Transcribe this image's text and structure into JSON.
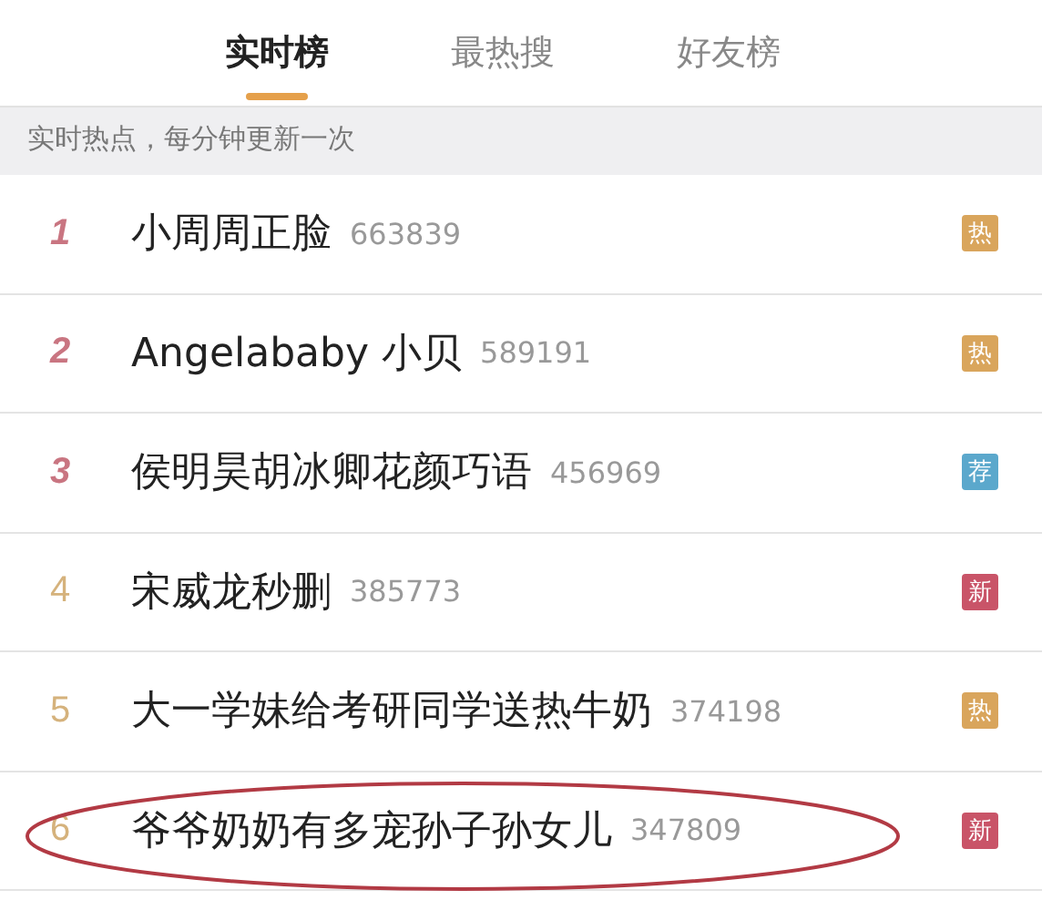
{
  "tabs": [
    {
      "label": "实时榜",
      "selected": true
    },
    {
      "label": "最热搜",
      "selected": false
    },
    {
      "label": "好友榜",
      "selected": false
    }
  ],
  "notice": "实时热点，每分钟更新一次",
  "rows": [
    {
      "rank": "1",
      "top": true,
      "title": "小周周正脸",
      "count": "663839",
      "badge": "热",
      "color": "#d9a55c",
      "circled": false
    },
    {
      "rank": "2",
      "top": true,
      "title": "Angelababy 小贝",
      "count": "589191",
      "badge": "热",
      "color": "#d9a55c",
      "circled": false
    },
    {
      "rank": "3",
      "top": true,
      "title": "侯明昊胡冰卿花颜巧语",
      "count": "456969",
      "badge": "荐",
      "color": "#5ba8cc",
      "circled": false
    },
    {
      "rank": "4",
      "top": false,
      "title": "宋威龙秒删",
      "count": "385773",
      "badge": "新",
      "color": "#c95468",
      "circled": false
    },
    {
      "rank": "5",
      "top": false,
      "title": "大一学妹给考研同学送热牛奶",
      "count": "374198",
      "badge": "热",
      "color": "#d9a55c",
      "circled": false
    },
    {
      "rank": "6",
      "top": false,
      "title": "爷爷奶奶有多宠孙子孙女儿",
      "count": "347809",
      "badge": "新",
      "color": "#c95468",
      "circled": true
    }
  ]
}
